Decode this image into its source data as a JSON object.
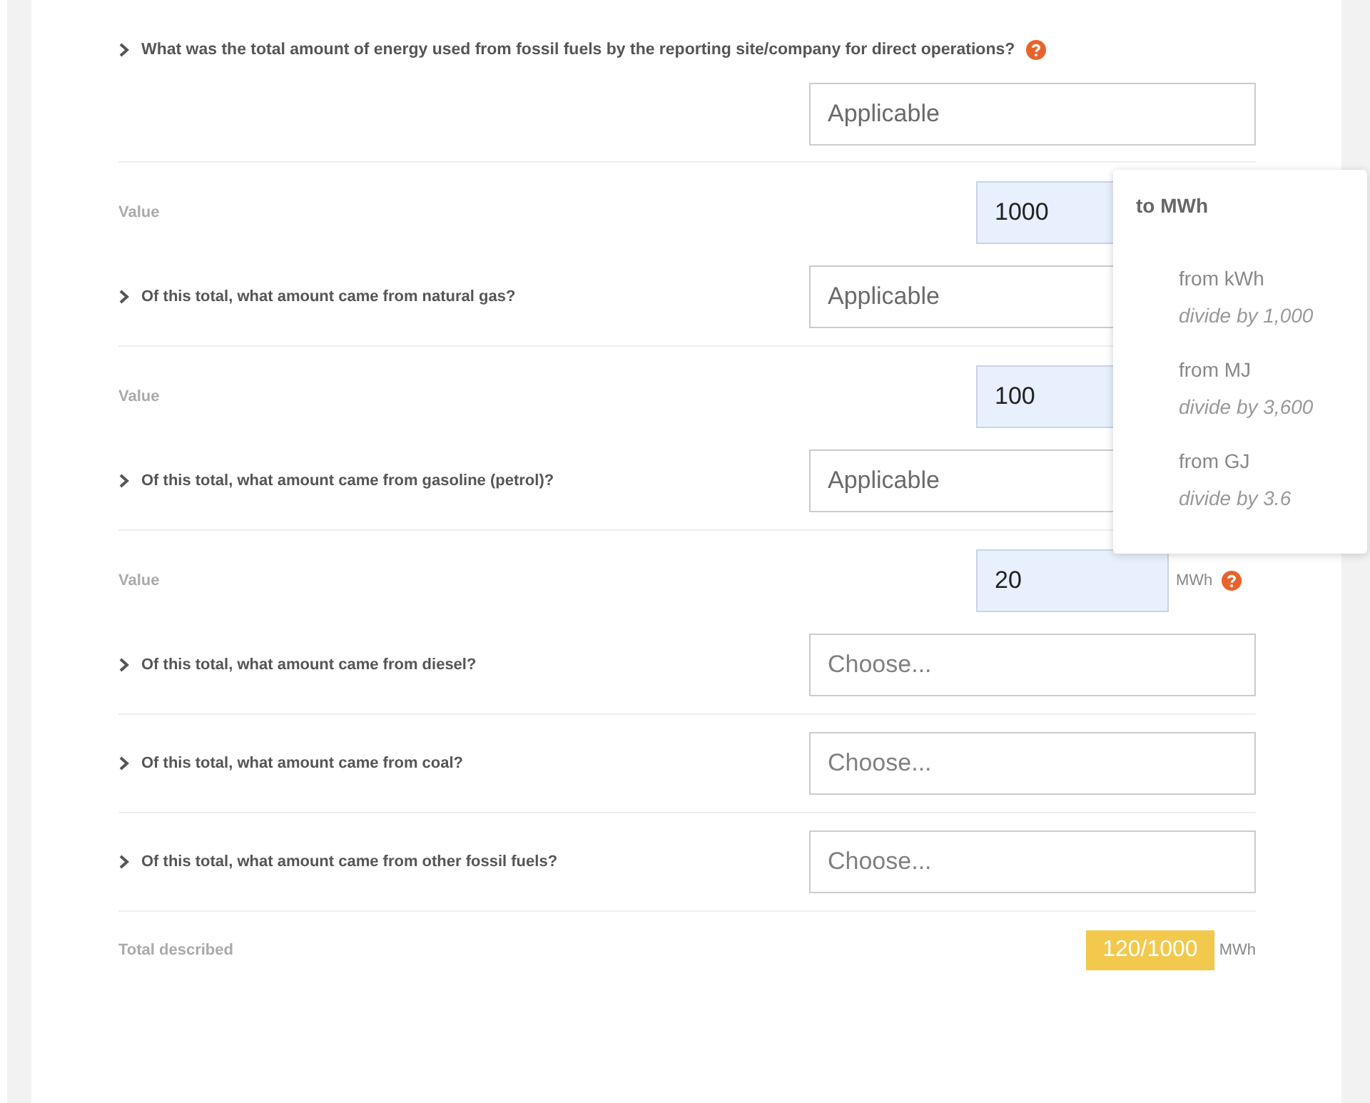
{
  "main_question": {
    "text": "What was the total amount of energy used from fossil fuels by the reporting site/company for direct operations?",
    "help": true,
    "select": {
      "value": "Applicable"
    },
    "value_row": {
      "label": "Value",
      "value": "1000"
    }
  },
  "sub_questions": [
    {
      "text": "Of this total, what amount came from natural gas?",
      "select": {
        "value": "Applicable"
      },
      "value_row": {
        "label": "Value",
        "value": "100"
      }
    },
    {
      "text": "Of this total, what amount came from gasoline (petrol)?",
      "select": {
        "value": "Applicable"
      },
      "value_row": {
        "label": "Value",
        "value": "20",
        "unit": "MWh",
        "help": true
      }
    },
    {
      "text": "Of this total, what amount came from diesel?",
      "select": {
        "placeholder": "Choose..."
      }
    },
    {
      "text": "Of this total, what amount came from coal?",
      "select": {
        "placeholder": "Choose..."
      }
    },
    {
      "text": "Of this total, what amount came from other fossil fuels?",
      "select": {
        "placeholder": "Choose..."
      }
    }
  ],
  "total": {
    "label": "Total described",
    "value": "120/1000",
    "unit": "MWh"
  },
  "popover": {
    "title": "to MWh",
    "conversions": [
      {
        "from": "from kWh",
        "rule": "divide by 1,000"
      },
      {
        "from": "from MJ",
        "rule": "divide by 3,600"
      },
      {
        "from": "from GJ",
        "rule": "divide by 3.6"
      }
    ]
  }
}
